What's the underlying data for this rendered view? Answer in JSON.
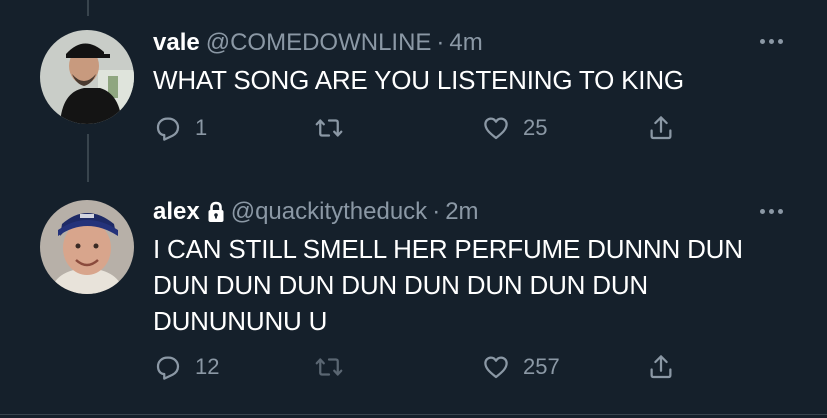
{
  "tweets": [
    {
      "name": "vale",
      "handle": "@COMEDOWNLINE",
      "dot": "·",
      "time": "4m",
      "text": "WHAT SONG ARE YOU LISTENING TO KING",
      "reply_count": "1",
      "retweet_count": "",
      "like_count": "25",
      "locked": false
    },
    {
      "name": "alex",
      "handle": "@quackitytheduck",
      "dot": "·",
      "time": "2m",
      "text": "I CAN STILL SMELL HER PERFUME DUNNN DUN DUN DUN DUN DUN DUN DUN DUN DUN DUNUNUNU U",
      "reply_count": "12",
      "retweet_count": "",
      "like_count": "257",
      "locked": true
    }
  ],
  "icons": {
    "reply": "reply-icon",
    "retweet": "retweet-icon",
    "like": "heart-icon",
    "share": "share-icon",
    "more": "more-icon",
    "lock": "lock-icon"
  },
  "colors": {
    "background": "#15202b",
    "text": "#ffffff",
    "secondary": "#8b98a5",
    "border": "#38444d"
  }
}
